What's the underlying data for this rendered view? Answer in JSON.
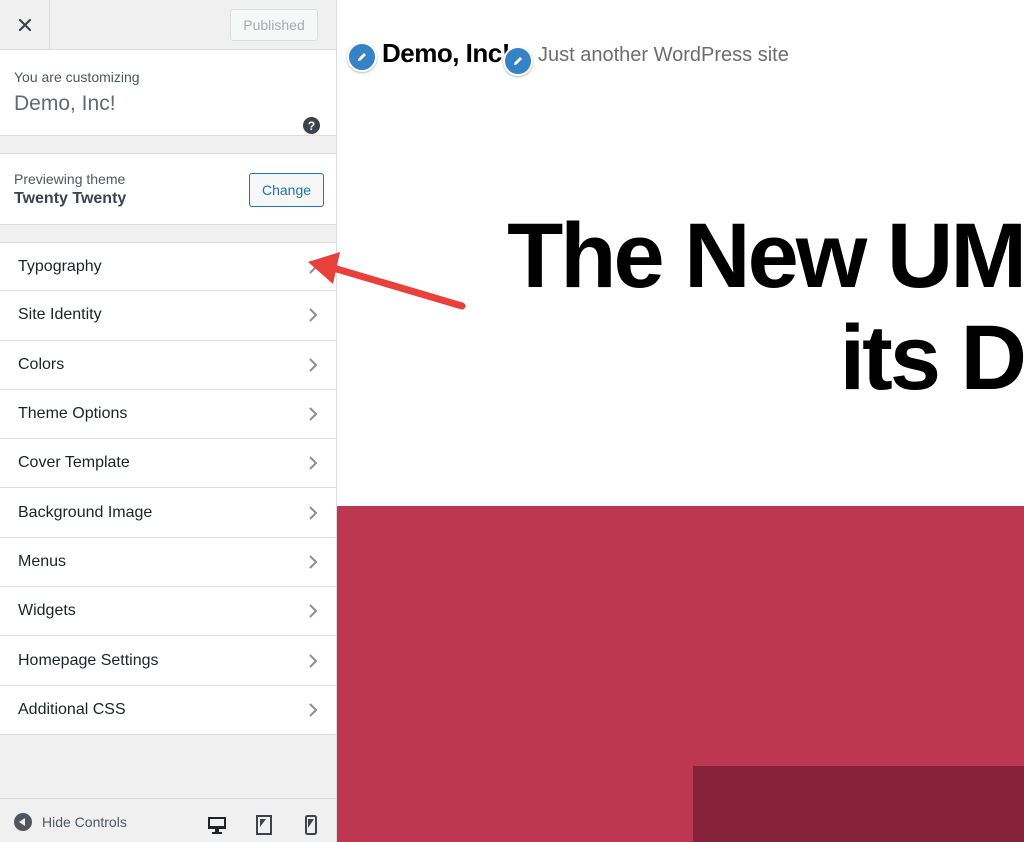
{
  "header": {
    "published_label": "Published"
  },
  "customizing": {
    "label": "You are customizing",
    "site_name": "Demo, Inc!"
  },
  "theme": {
    "label": "Previewing theme",
    "name": "Twenty Twenty",
    "change_label": "Change"
  },
  "sections": [
    {
      "label": "Typography"
    },
    {
      "label": "Site Identity"
    },
    {
      "label": "Colors"
    },
    {
      "label": "Theme Options"
    },
    {
      "label": "Cover Template"
    },
    {
      "label": "Background Image"
    },
    {
      "label": "Menus"
    },
    {
      "label": "Widgets"
    },
    {
      "label": "Homepage Settings"
    },
    {
      "label": "Additional CSS"
    }
  ],
  "footer": {
    "hide_controls_label": "Hide Controls",
    "devices": [
      "desktop-icon",
      "tablet-icon",
      "mobile-icon"
    ]
  },
  "preview": {
    "site_title": "Demo, Inc!",
    "tagline": "Just another WordPress site",
    "hero_line1": "The New UM",
    "hero_line2": "its D",
    "colors": {
      "accent": "#bd3753",
      "accent_dark": "#86233b",
      "edit_shortcut": "#3582c4",
      "annotation_arrow": "#e8413b"
    }
  }
}
